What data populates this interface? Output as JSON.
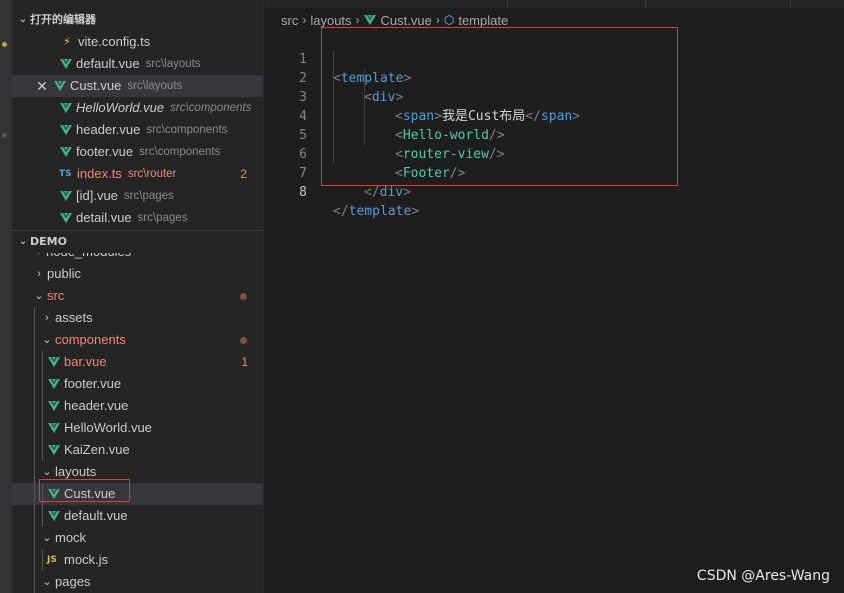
{
  "open_editors": {
    "title": "打开的编辑器",
    "items": [
      {
        "name": "vite.config.ts",
        "path": "",
        "icon": "bolt-icon"
      },
      {
        "name": "default.vue",
        "path": "src\\layouts",
        "icon": "vue-icon"
      },
      {
        "name": "Cust.vue",
        "path": "src\\layouts",
        "icon": "vue-icon",
        "active": true
      },
      {
        "name": "HelloWorld.vue",
        "path": "src\\components",
        "icon": "vue-icon",
        "italic": true
      },
      {
        "name": "header.vue",
        "path": "src\\components",
        "icon": "vue-icon"
      },
      {
        "name": "footer.vue",
        "path": "src\\components",
        "icon": "vue-icon"
      },
      {
        "name": "index.ts",
        "path": "src\\router",
        "icon": "ts-icon",
        "error": true,
        "badge": "2"
      },
      {
        "name": "[id].vue",
        "path": "src\\pages",
        "icon": "vue-icon"
      },
      {
        "name": "detail.vue",
        "path": "src\\pages",
        "icon": "vue-icon"
      }
    ]
  },
  "explorer": {
    "title": "DEMO",
    "cut_item": "node_modules",
    "public": "public",
    "src": "src",
    "assets": "assets",
    "components": "components",
    "bar": "bar.vue",
    "bar_badge": "1",
    "footer": "footer.vue",
    "header": "header.vue",
    "helloworld": "HelloWorld.vue",
    "kaizen": "KaiZen.vue",
    "layouts": "layouts",
    "cust": "Cust.vue",
    "default": "default.vue",
    "mock": "mock",
    "mockjs": "mock.js",
    "pages": "pages"
  },
  "icons": {
    "ts": "TS",
    "js": "JS"
  },
  "breadcrumb": {
    "p1": "src",
    "p2": "layouts",
    "p3": "Cust.vue",
    "p4": "template"
  },
  "code": {
    "line_numbers": [
      "1",
      "2",
      "3",
      "4",
      "5",
      "6",
      "7",
      "8"
    ],
    "l1_open": "<",
    "l1_tag": "template",
    "l1_close": ">",
    "l2_open": "<",
    "l2_tag": "div",
    "l2_close": ">",
    "l3_open": "<",
    "l3_tag": "span",
    "l3_mid": ">",
    "l3_text": "我是Cust布局",
    "l3_open2": "</",
    "l3_tag2": "span",
    "l3_close": ">",
    "l4_open": "<",
    "l4_tag": "Hello-world",
    "l4_close": "/>",
    "l5_open": "<",
    "l5_tag": "router-view",
    "l5_close": "/>",
    "l6_open": "<",
    "l6_tag": "Footer",
    "l6_close": "/>",
    "l7_open": "</",
    "l7_tag": "div",
    "l7_close": ">",
    "l8_open": "</",
    "l8_tag": "template",
    "l8_close": ">"
  },
  "watermark": "CSDN @Ares-Wang",
  "colors": {
    "vue": "#41b883",
    "error": "#f48771",
    "tag": "#569cd6",
    "component": "#4ec9b0",
    "highlight_box": "#e53935"
  }
}
